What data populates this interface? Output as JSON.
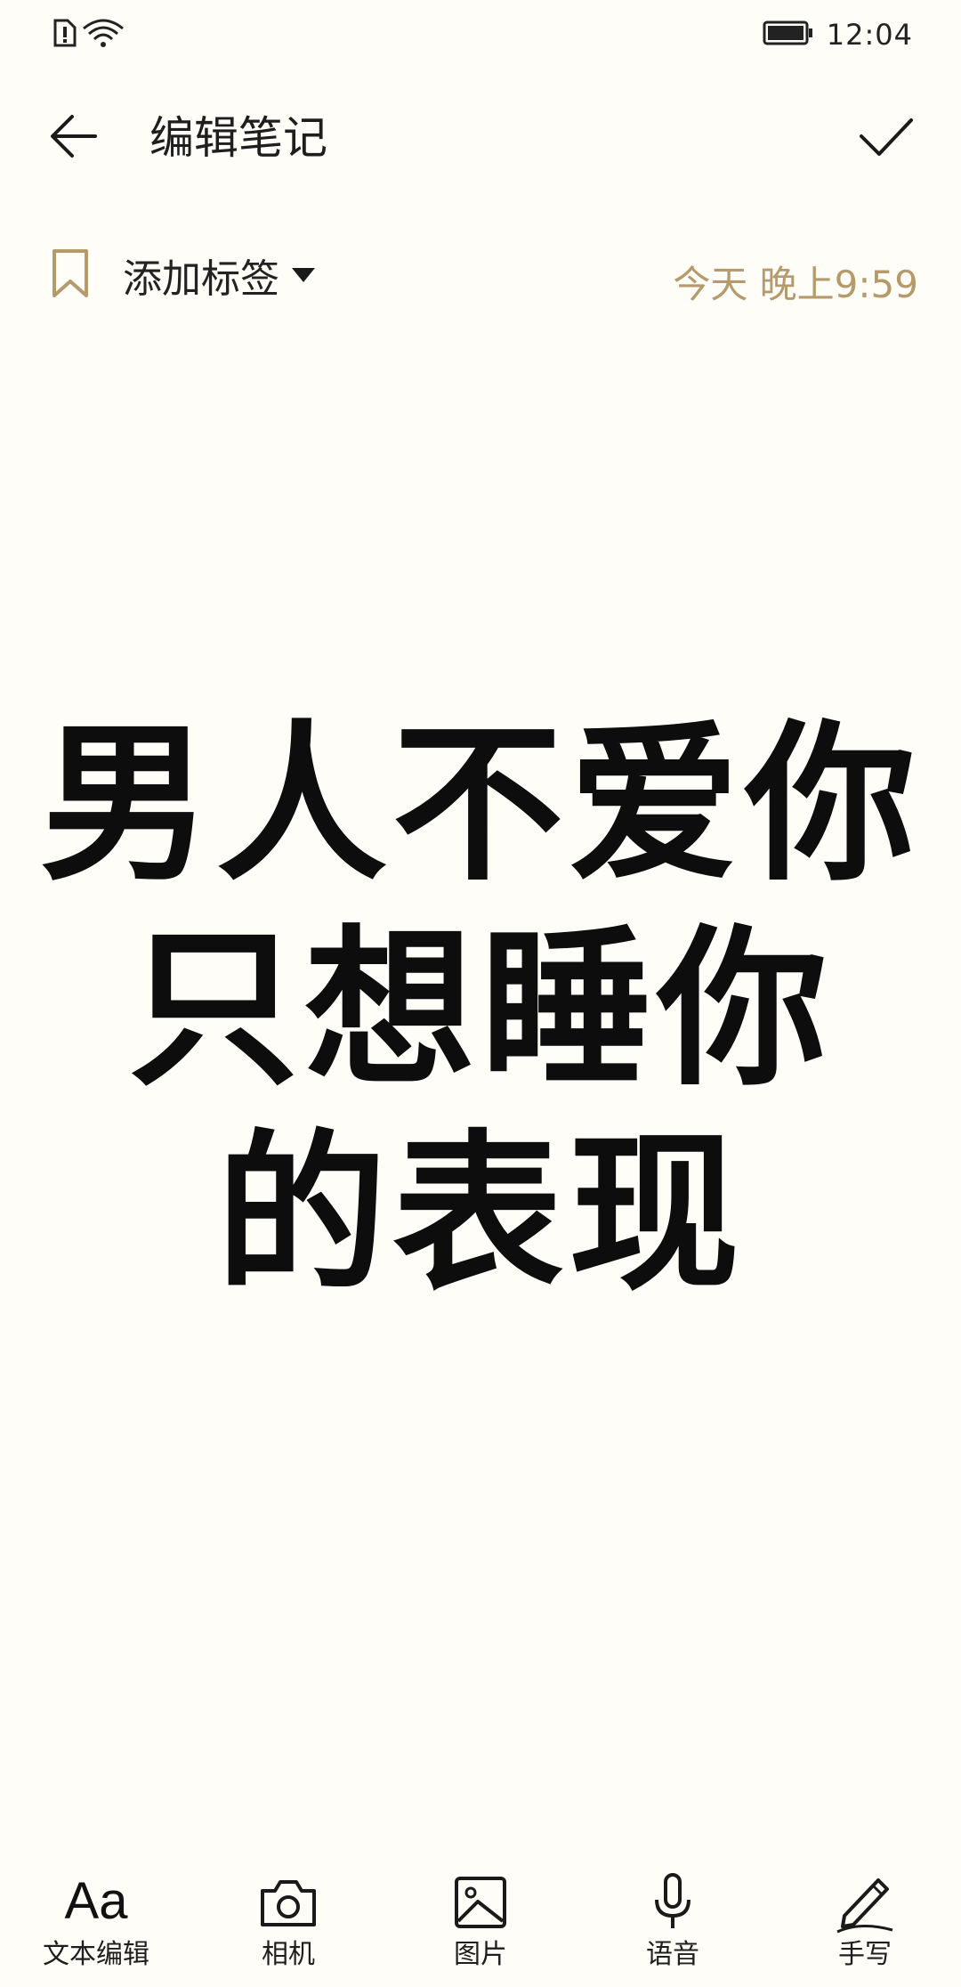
{
  "status_bar": {
    "time": "12:04",
    "left_icons": [
      "sim-alert-icon",
      "wifi-icon"
    ],
    "right_icons": [
      "battery-icon"
    ]
  },
  "app_bar": {
    "title": "编辑笔记",
    "back_icon": "arrow-left-icon",
    "done_icon": "checkmark-icon"
  },
  "tag_bar": {
    "label": "添加标签",
    "icon": "bookmark-icon",
    "timestamp": "今天 晚上9:59"
  },
  "note": {
    "lines": [
      "男人不爱你",
      "只想睡你",
      "的表现"
    ]
  },
  "toolbar": {
    "items": [
      {
        "label": "文本编辑",
        "icon": "text-format-icon"
      },
      {
        "label": "相机",
        "icon": "camera-icon"
      },
      {
        "label": "图片",
        "icon": "image-icon"
      },
      {
        "label": "语音",
        "icon": "microphone-icon"
      },
      {
        "label": "手写",
        "icon": "pen-icon"
      }
    ]
  },
  "colors": {
    "background": "#fffdf8",
    "accent_gold": "#b59a6c",
    "text": "#1a1a1a"
  }
}
